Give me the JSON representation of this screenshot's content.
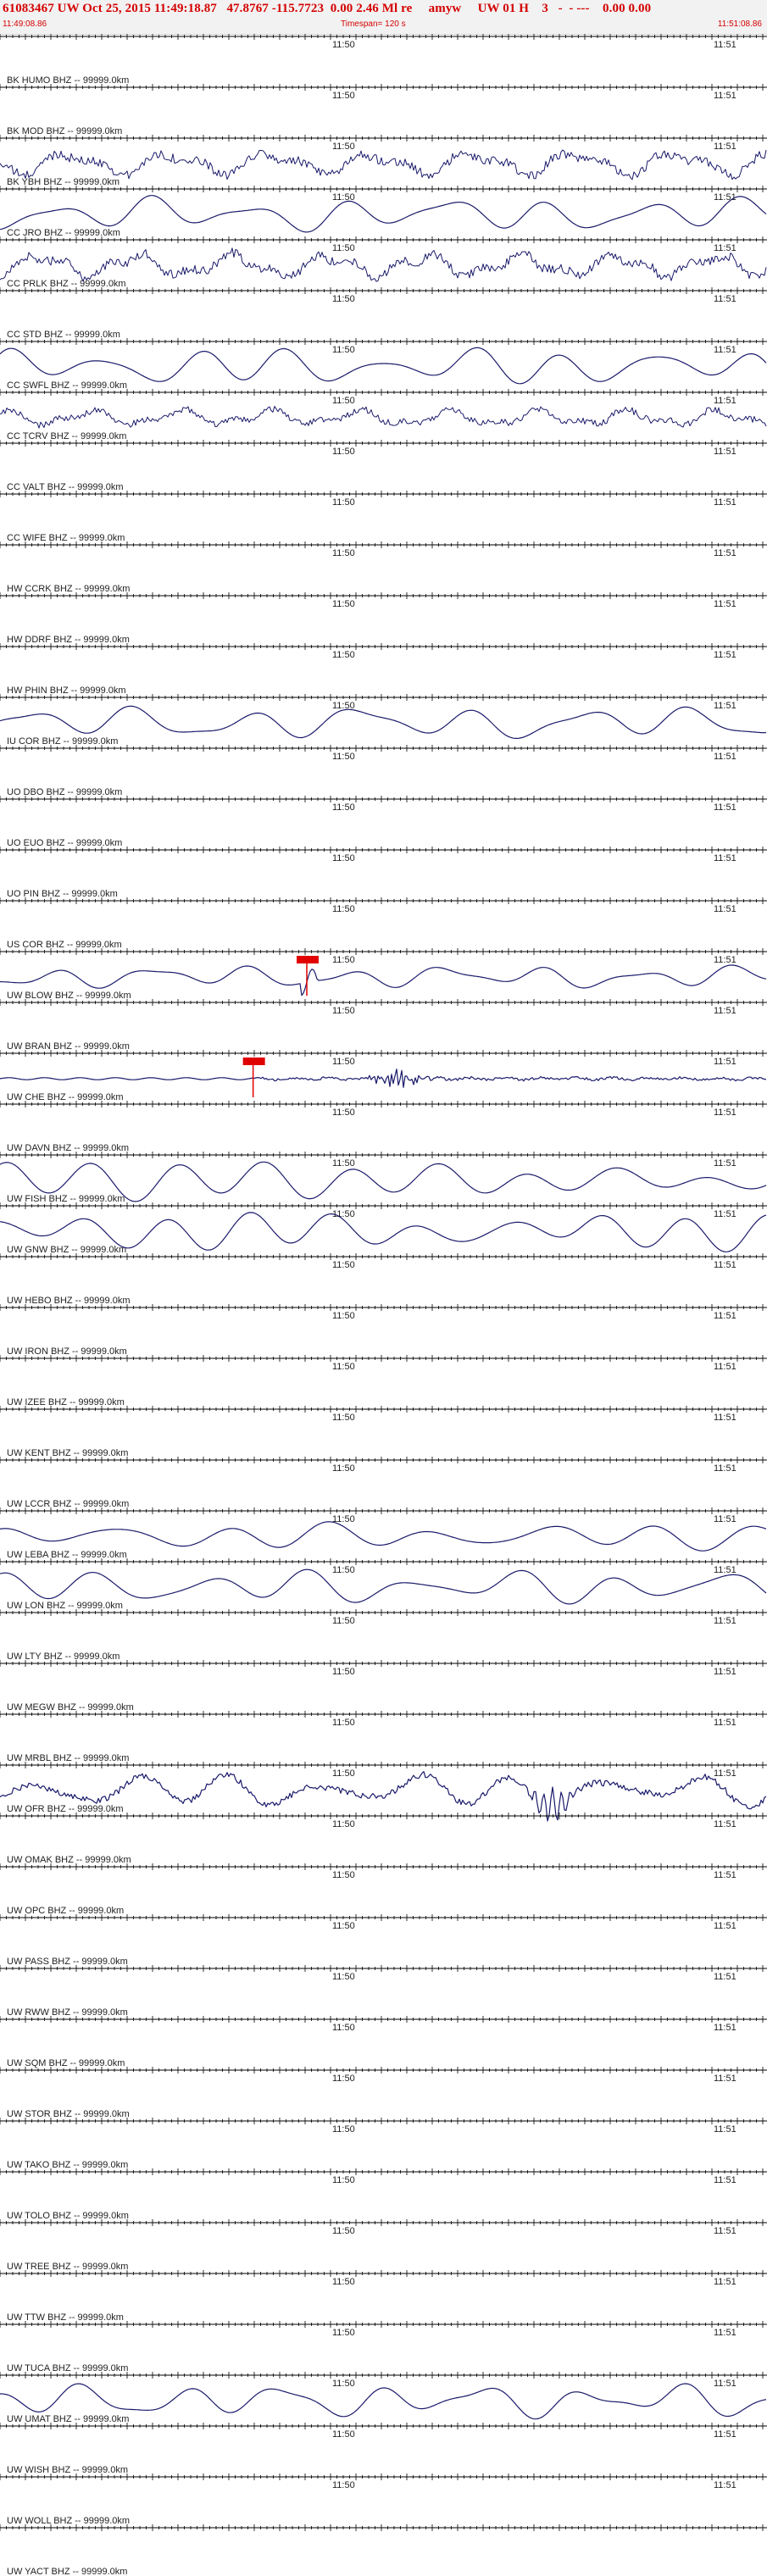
{
  "header": {
    "title": "61083467 UW Oct 25, 2015 11:49:18.87   47.8767 -115.7723  0.00 2.46 Ml re     amyw     UW 01 H    3   -  - ---    0.00 0.00",
    "start_time": "11:49:08.86",
    "timespan": "Timespan= 120 s",
    "end_time": "11:51:08.86"
  },
  "colors": {
    "trace": "#1a1a6b",
    "text_red": "#d40000",
    "pick": "#e00000",
    "axis": "#000000",
    "header_bg": "#f2f2f2"
  },
  "chart_data": {
    "type": "line",
    "title": "",
    "xlabel": "",
    "ylabel": "",
    "xlim": [
      "11:49:08.86",
      "11:51:08.86"
    ],
    "x_tick_labels": [
      "11:50",
      "11:51"
    ],
    "stations": [
      {
        "name": "BK HUMO BHZ -- 99999.0km",
        "x_label_1": "11:50",
        "x_label_2": "11:51",
        "trace": "flat",
        "amp": 0
      },
      {
        "name": "BK MOD BHZ -- 99999.0km",
        "x_label_1": "11:50",
        "x_label_2": "11:51",
        "trace": "flat",
        "amp": 0
      },
      {
        "name": "BK YBH BHZ -- 99999.0km",
        "x_label_1": "11:50",
        "x_label_2": "11:51",
        "trace": "noisy",
        "amp": 1.0
      },
      {
        "name": "CC JRO BHZ -- 99999.0km",
        "x_label_1": "11:50",
        "x_label_2": "11:51",
        "trace": "wave",
        "amp": 0.9
      },
      {
        "name": "CC PRLK BHZ -- 99999.0km",
        "x_label_1": "11:50",
        "x_label_2": "11:51",
        "trace": "noisy",
        "amp": 1.0
      },
      {
        "name": "CC STD BHZ -- 99999.0km",
        "x_label_1": "11:50",
        "x_label_2": "11:51",
        "trace": "flat",
        "amp": 0
      },
      {
        "name": "CC SWFL BHZ -- 99999.0km",
        "x_label_1": "11:50",
        "x_label_2": "11:51",
        "trace": "wave",
        "amp": 1.0
      },
      {
        "name": "CC TCRV BHZ -- 99999.0km",
        "x_label_1": "11:50",
        "x_label_2": "11:51",
        "trace": "noisy",
        "amp": 0.7
      },
      {
        "name": "CC VALT BHZ -- 99999.0km",
        "x_label_1": "11:50",
        "x_label_2": "11:51",
        "trace": "flat",
        "amp": 0
      },
      {
        "name": "CC WIFE BHZ -- 99999.0km",
        "x_label_1": "11:50",
        "x_label_2": "11:51",
        "trace": "flat",
        "amp": 0
      },
      {
        "name": "HW CCRK BHZ -- 99999.0km",
        "x_label_1": "11:50",
        "x_label_2": "11:51",
        "trace": "flat",
        "amp": 0
      },
      {
        "name": "HW DDRF BHZ -- 99999.0km",
        "x_label_1": "11:50",
        "x_label_2": "11:51",
        "trace": "flat",
        "amp": 0
      },
      {
        "name": "HW PHIN BHZ -- 99999.0km",
        "x_label_1": "11:50",
        "x_label_2": "11:51",
        "trace": "flat",
        "amp": 0
      },
      {
        "name": "IU COR BHZ -- 99999.0km",
        "x_label_1": "11:50",
        "x_label_2": "11:51",
        "trace": "wave",
        "amp": 0.9
      },
      {
        "name": "UO DBO BHZ -- 99999.0km",
        "x_label_1": "11:50",
        "x_label_2": "11:51",
        "trace": "flat",
        "amp": 0
      },
      {
        "name": "UO EUO BHZ -- 99999.0km",
        "x_label_1": "11:50",
        "x_label_2": "11:51",
        "trace": "flat",
        "amp": 0
      },
      {
        "name": "UO PIN BHZ -- 99999.0km",
        "x_label_1": "11:50",
        "x_label_2": "11:51",
        "trace": "flat",
        "amp": 0
      },
      {
        "name": "US COR BHZ -- 99999.0km",
        "x_label_1": "11:50",
        "x_label_2": "11:51",
        "trace": "flat",
        "amp": 0
      },
      {
        "name": "UW BLOW BHZ -- 99999.0km",
        "x_label_1": "11:50",
        "x_label_2": "11:51",
        "trace": "wave",
        "amp": 0.6,
        "pick_frac": 0.4
      },
      {
        "name": "UW BRAN BHZ -- 99999.0km",
        "x_label_1": "11:50",
        "x_label_2": "11:51",
        "trace": "flat",
        "amp": 0
      },
      {
        "name": "UW CHE BHZ -- 99999.0km",
        "x_label_1": "11:50",
        "x_label_2": "11:51",
        "trace": "event",
        "amp": 0.8,
        "pick_frac": 0.33
      },
      {
        "name": "UW DAVN BHZ -- 99999.0km",
        "x_label_1": "11:50",
        "x_label_2": "11:51",
        "trace": "flat",
        "amp": 0
      },
      {
        "name": "UW FISH BHZ -- 99999.0km",
        "x_label_1": "11:50",
        "x_label_2": "11:51",
        "trace": "wave",
        "amp": 1.0
      },
      {
        "name": "UW GNW BHZ -- 99999.0km",
        "x_label_1": "11:50",
        "x_label_2": "11:51",
        "trace": "wave",
        "amp": 1.0
      },
      {
        "name": "UW HEBO BHZ -- 99999.0km",
        "x_label_1": "11:50",
        "x_label_2": "11:51",
        "trace": "flat",
        "amp": 0
      },
      {
        "name": "UW IRON BHZ -- 99999.0km",
        "x_label_1": "11:50",
        "x_label_2": "11:51",
        "trace": "flat",
        "amp": 0
      },
      {
        "name": "UW IZEE BHZ -- 99999.0km",
        "x_label_1": "11:50",
        "x_label_2": "11:51",
        "trace": "flat",
        "amp": 0
      },
      {
        "name": "UW KENT BHZ -- 99999.0km",
        "x_label_1": "11:50",
        "x_label_2": "11:51",
        "trace": "flat",
        "amp": 0
      },
      {
        "name": "UW LCCR BHZ -- 99999.0km",
        "x_label_1": "11:50",
        "x_label_2": "11:51",
        "trace": "flat",
        "amp": 0
      },
      {
        "name": "UW LEBA BHZ -- 99999.0km",
        "x_label_1": "11:50",
        "x_label_2": "11:51",
        "trace": "wave",
        "amp": 0.7
      },
      {
        "name": "UW LON BHZ -- 99999.0km",
        "x_label_1": "11:50",
        "x_label_2": "11:51",
        "trace": "wave",
        "amp": 0.9
      },
      {
        "name": "UW LTY BHZ -- 99999.0km",
        "x_label_1": "11:50",
        "x_label_2": "11:51",
        "trace": "flat",
        "amp": 0
      },
      {
        "name": "UW MEGW BHZ -- 99999.0km",
        "x_label_1": "11:50",
        "x_label_2": "11:51",
        "trace": "flat",
        "amp": 0
      },
      {
        "name": "UW MRBL BHZ -- 99999.0km",
        "x_label_1": "11:50",
        "x_label_2": "11:51",
        "trace": "flat",
        "amp": 0
      },
      {
        "name": "UW OFR BHZ -- 99999.0km",
        "x_label_1": "11:50",
        "x_label_2": "11:51",
        "trace": "wave",
        "amp": 0.9,
        "burst_frac": 0.72
      },
      {
        "name": "UW OMAK BHZ -- 99999.0km",
        "x_label_1": "11:50",
        "x_label_2": "11:51",
        "trace": "flat",
        "amp": 0
      },
      {
        "name": "UW OPC BHZ -- 99999.0km",
        "x_label_1": "11:50",
        "x_label_2": "11:51",
        "trace": "flat",
        "amp": 0
      },
      {
        "name": "UW PASS BHZ -- 99999.0km",
        "x_label_1": "11:50",
        "x_label_2": "11:51",
        "trace": "flat",
        "amp": 0
      },
      {
        "name": "UW RWW BHZ -- 99999.0km",
        "x_label_1": "11:50",
        "x_label_2": "11:51",
        "trace": "flat",
        "amp": 0
      },
      {
        "name": "UW SQM BHZ -- 99999.0km",
        "x_label_1": "11:50",
        "x_label_2": "11:51",
        "trace": "flat",
        "amp": 0
      },
      {
        "name": "UW STOR BHZ -- 99999.0km",
        "x_label_1": "11:50",
        "x_label_2": "11:51",
        "trace": "flat",
        "amp": 0
      },
      {
        "name": "UW TAKO BHZ -- 99999.0km",
        "x_label_1": "11:50",
        "x_label_2": "11:51",
        "trace": "flat",
        "amp": 0
      },
      {
        "name": "UW TOLO BHZ -- 99999.0km",
        "x_label_1": "11:50",
        "x_label_2": "11:51",
        "trace": "flat",
        "amp": 0
      },
      {
        "name": "UW TREE BHZ -- 99999.0km",
        "x_label_1": "11:50",
        "x_label_2": "11:51",
        "trace": "flat",
        "amp": 0
      },
      {
        "name": "UW TTW BHZ -- 99999.0km",
        "x_label_1": "11:50",
        "x_label_2": "11:51",
        "trace": "flat",
        "amp": 0
      },
      {
        "name": "UW TUCA BHZ -- 99999.0km",
        "x_label_1": "11:50",
        "x_label_2": "11:51",
        "trace": "flat",
        "amp": 0
      },
      {
        "name": "UW UMAT BHZ -- 99999.0km",
        "x_label_1": "11:50",
        "x_label_2": "11:51",
        "trace": "wave",
        "amp": 0.9
      },
      {
        "name": "UW WISH BHZ -- 99999.0km",
        "x_label_1": "11:50",
        "x_label_2": "11:51",
        "trace": "flat",
        "amp": 0
      },
      {
        "name": "UW WOLL BHZ -- 99999.0km",
        "x_label_1": "11:50",
        "x_label_2": "11:51",
        "trace": "flat",
        "amp": 0
      },
      {
        "name": "UW YACT BHZ -- 99999.0km",
        "x_label_1": "",
        "x_label_2": "",
        "trace": "flat",
        "amp": 0
      }
    ]
  }
}
